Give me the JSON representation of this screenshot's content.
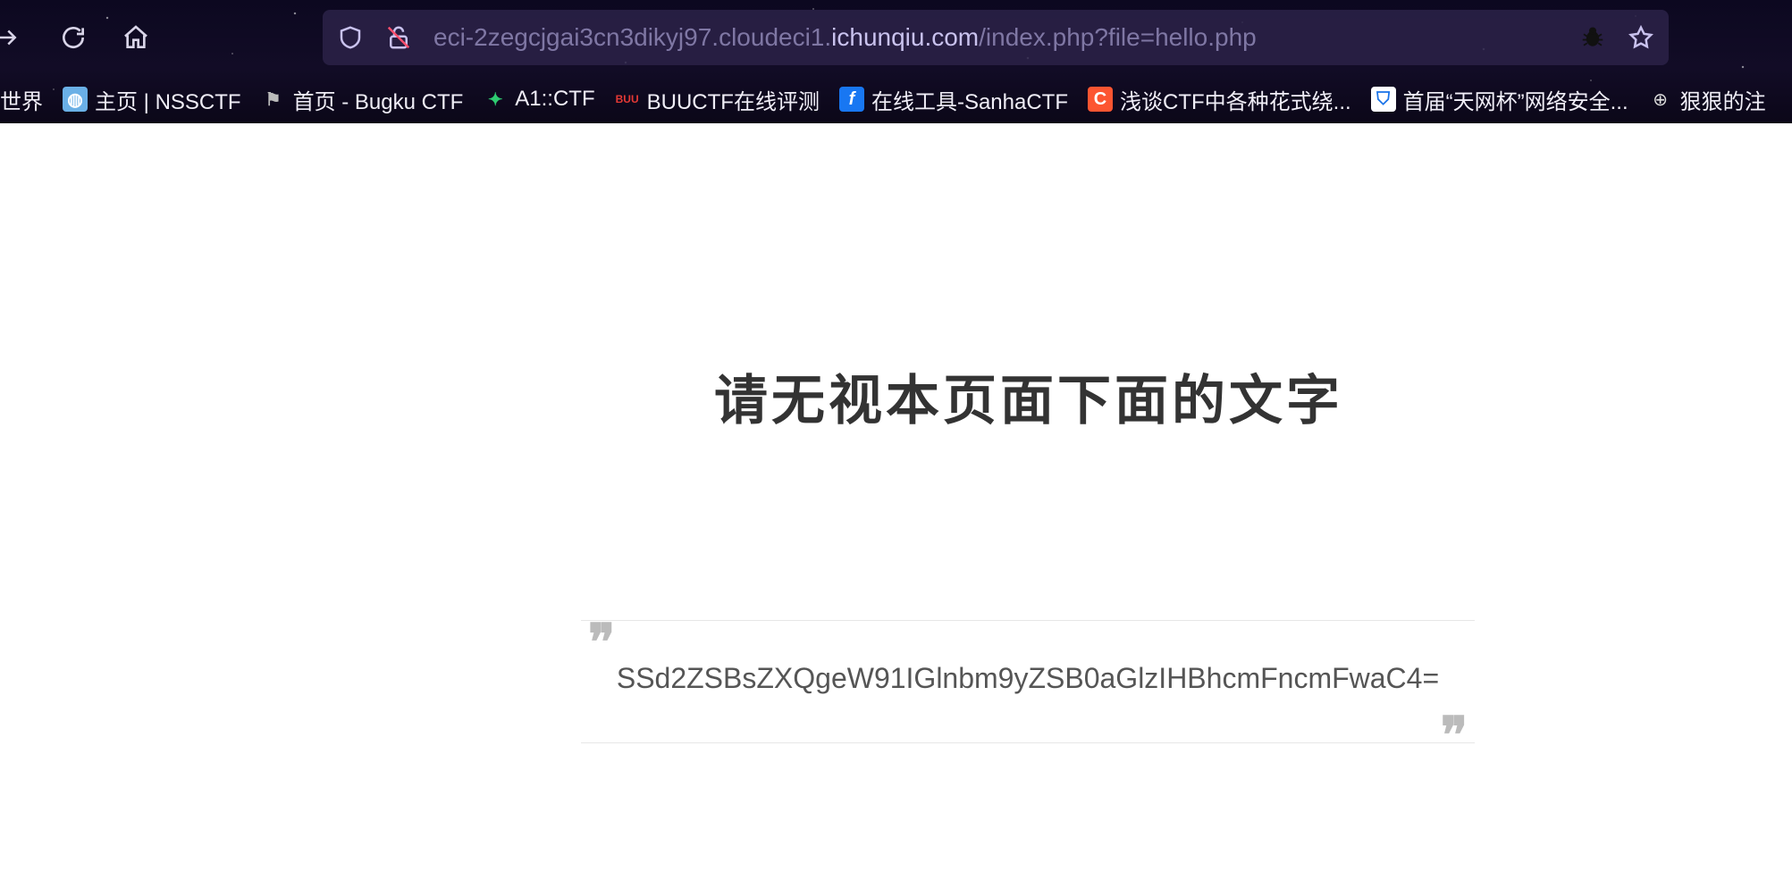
{
  "browser": {
    "url_prefix": "eci-2zegcjgai3cn3dikyj97.cloudeci1.",
    "url_host": "ichunqiu.com",
    "url_suffix": "/index.php?file=hello.php"
  },
  "bookmarks": [
    {
      "label": "世界",
      "icon": "globe-icon",
      "color": "#ffffff"
    },
    {
      "label": "主页 | NSSCTF",
      "icon": "nssctf-icon",
      "color": "#6ab0e6"
    },
    {
      "label": "首页 - Bugku CTF",
      "icon": "flag-icon",
      "color": "#888888"
    },
    {
      "label": "A1::CTF",
      "icon": "a1ctf-icon",
      "color": "#2ecc71"
    },
    {
      "label": "BUUCTF在线评测",
      "icon": "buuctf-icon",
      "color": "#e53935"
    },
    {
      "label": "在线工具-SanhaCTF",
      "icon": "f-icon",
      "color": "#1877f2"
    },
    {
      "label": "浅谈CTF中各种花式绕...",
      "icon": "c-icon",
      "color": "#fc5531"
    },
    {
      "label": "首届“天网杯”网络安全...",
      "icon": "shield-icon",
      "color": "#1a73e8"
    },
    {
      "label": "狠狠的注",
      "icon": "globe-icon",
      "color": "#ffffff"
    }
  ],
  "page": {
    "title": "请无视本页面下面的文字",
    "quote_text": "SSd2ZSBsZXQgeW91IGlnbm9yZSB0aGlzIHBhcmFncmFwaC4="
  }
}
